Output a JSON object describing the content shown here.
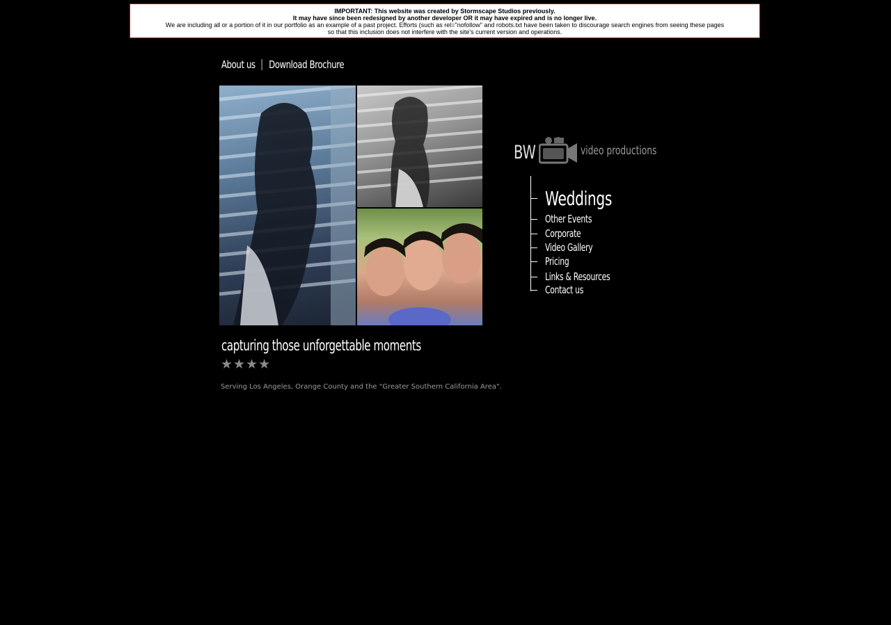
{
  "notice": {
    "line1": "IMPORTANT: This website was created by Stormscape Studios previously.",
    "line2": "It may have since been redesigned by another developer OR it may have expired and is no longer live.",
    "line3": "We are including all or a portion of it in our portfolio as an example of a past project. Efforts (such as rel=\"nofollow\" and robots.txt have been taken to discourage search engines from seeing these pages",
    "line4": "so that this inclusion does not interfere with the site's current version and operations.",
    "border_color": "#b00000"
  },
  "topnav": {
    "about": "About us",
    "brochure": "Download Brochure"
  },
  "logo": {
    "bw": "BW",
    "tagline": "video productions",
    "icon": "video-camera-icon"
  },
  "menu": {
    "items": [
      {
        "label": "Weddings",
        "active": true
      },
      {
        "label": "Other Events"
      },
      {
        "label": "Corporate"
      },
      {
        "label": "Video Gallery"
      },
      {
        "label": "Pricing"
      },
      {
        "label": "Links & Resources"
      },
      {
        "label": "Contact us"
      }
    ]
  },
  "main": {
    "tagline": "capturing those unforgettable moments",
    "stars": "★★★★",
    "serving": "Serving Los Angeles, Orange County and the \"Greater Southern California Area\"."
  }
}
